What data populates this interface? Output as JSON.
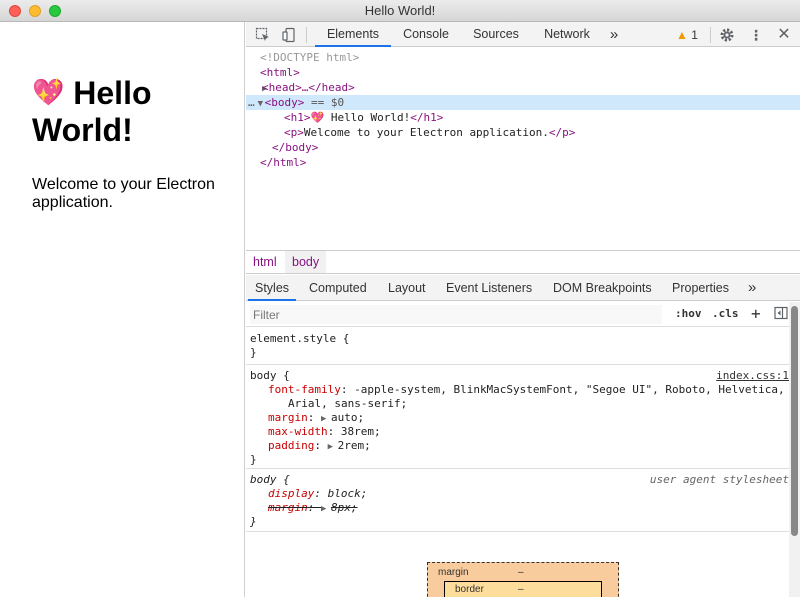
{
  "window": {
    "title": "Hello World!"
  },
  "app": {
    "heading_emoji": "💖",
    "heading": "Hello World!",
    "paragraph": "Welcome to your Electron application."
  },
  "devtools": {
    "tabs": [
      "Elements",
      "Console",
      "Sources",
      "Network"
    ],
    "overflow_label": "»",
    "warning_count": "1",
    "dom": {
      "doctype": "<!DOCTYPE html>",
      "html_open": "<html>",
      "head_collapsed": "<head>…</head>",
      "body_open": "<body>",
      "body_suffix": "== $0",
      "h1_open": "<h1>",
      "h1_text": "💖 Hello World!",
      "h1_close": "</h1>",
      "p_open": "<p>",
      "p_text": "Welcome to your Electron application.",
      "p_close": "</p>",
      "body_close": "</body>",
      "html_close": "</html>"
    },
    "breadcrumbs": [
      "html",
      "body"
    ],
    "sub_tabs": [
      "Styles",
      "Computed",
      "Layout",
      "Event Listeners",
      "DOM Breakpoints",
      "Properties"
    ],
    "filter_placeholder": "Filter",
    "hov_label": ":hov",
    "cls_label": ".cls",
    "plus_label": "+",
    "styles": {
      "element_style": "element.style {",
      "close_brace": "}",
      "body_rule_selector": "body {",
      "body_rule_source": "index.css:1",
      "font_family_prop": "font-family",
      "font_family_val": "-apple-system, BlinkMacSystemFont, \"Segoe UI\", Roboto, Helvetica,",
      "font_family_val2": "Arial, sans-serif;",
      "margin_prop": "margin",
      "margin_val": "auto;",
      "max_width_prop": "max-width",
      "max_width_val": "38rem;",
      "padding_prop": "padding",
      "padding_val": "2rem;",
      "ua_selector": "body {",
      "ua_source": "user agent stylesheet",
      "display_prop": "display",
      "display_val": "block;",
      "ua_margin_prop": "margin",
      "ua_margin_val": "8px;"
    },
    "box_model": {
      "margin_label": "margin",
      "margin_value": "–",
      "border_label": "border",
      "border_value": "–"
    }
  }
}
